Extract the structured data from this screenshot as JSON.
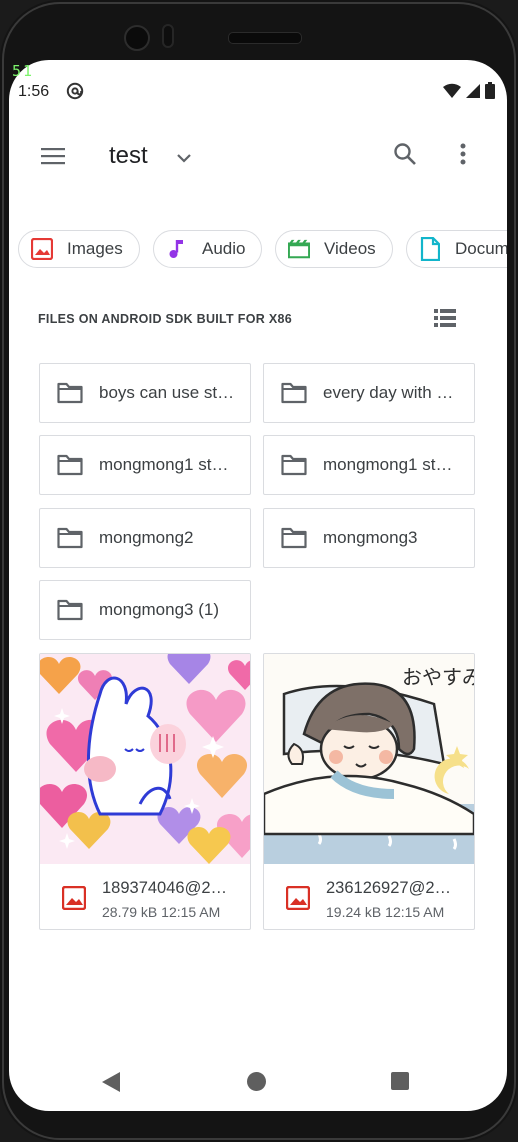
{
  "debug_label": "51",
  "status_bar": {
    "time": "1:56"
  },
  "app_bar": {
    "title": "test"
  },
  "chips": [
    {
      "label": "Images",
      "icon": "image-icon",
      "color": "#e53935"
    },
    {
      "label": "Audio",
      "icon": "music-note-icon",
      "color": "#9334e6"
    },
    {
      "label": "Videos",
      "icon": "movie-icon",
      "color": "#34a853"
    },
    {
      "label": "Docum",
      "icon": "document-icon",
      "color": "#12b5cb"
    }
  ],
  "section": {
    "title": "FILES ON ANDROID SDK BUILT FOR X86"
  },
  "folders": [
    {
      "name": "boys can use st…"
    },
    {
      "name": "every day with …"
    },
    {
      "name": "mongmong1 st…"
    },
    {
      "name": "mongmong1 st…"
    },
    {
      "name": "mongmong2"
    },
    {
      "name": "mongmong3"
    },
    {
      "name": "mongmong3 (1)"
    }
  ],
  "files": [
    {
      "name": "189374046@2…",
      "size": "28.79 kB",
      "time": "12:15 AM",
      "meta": "28.79 kB 12:15 AM"
    },
    {
      "name": "236126927@2…",
      "size": "19.24 kB",
      "time": "12:15 AM",
      "meta": "19.24 kB 12:15 AM",
      "thumb_text": "おやすみ"
    }
  ],
  "colors": {
    "accent_red": "#d93025",
    "icon_gray": "#5f6368"
  }
}
